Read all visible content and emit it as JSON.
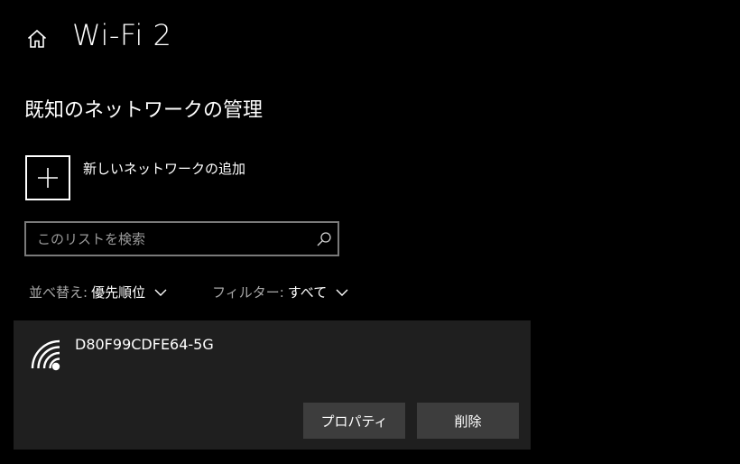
{
  "header": {
    "home_icon": "home-icon",
    "title": "Wi-Fi 2"
  },
  "section": {
    "title": "既知のネットワークの管理"
  },
  "add_network": {
    "icon": "plus-icon",
    "label": "新しいネットワークの追加"
  },
  "search": {
    "placeholder": "このリストを検索",
    "value": "",
    "icon": "search-icon"
  },
  "sort": {
    "label": "並べ替え:",
    "value": "優先順位"
  },
  "filter": {
    "label": "フィルター:",
    "value": "すべて"
  },
  "networks": [
    {
      "ssid": "D80F99CDFE64-5G",
      "icon": "wifi-signal-icon",
      "buttons": {
        "properties": "プロパティ",
        "delete": "削除"
      }
    }
  ],
  "colors": {
    "background": "#000000",
    "card": "#1f1f1f",
    "button": "#3d3d3d",
    "text": "#ffffff",
    "muted_text": "#a8a8a8",
    "search_border": "#7a7a7a"
  }
}
